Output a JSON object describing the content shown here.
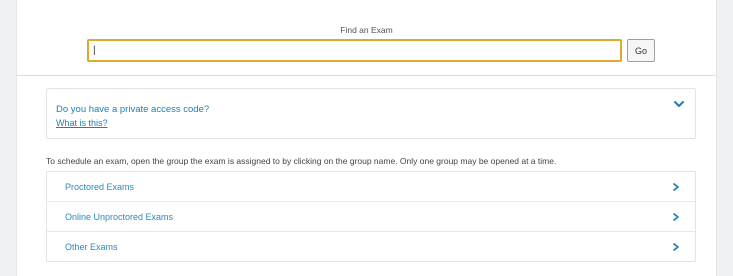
{
  "search": {
    "label": "Find an Exam",
    "value": "|",
    "go_label": "Go"
  },
  "access_code": {
    "question": "Do you have a private access code?",
    "link": "What is this?",
    "chevron_icon": "chevron-down-icon"
  },
  "instructions": "To schedule an exam, open the group the exam is assigned to by clicking on the group name. Only one group may be opened at a time.",
  "groups": [
    {
      "label": "Proctored Exams",
      "icon": "chevron-right-icon"
    },
    {
      "label": "Online Unproctored Exams",
      "icon": "chevron-right-icon"
    },
    {
      "label": "Other Exams",
      "icon": "chevron-right-icon"
    }
  ],
  "colors": {
    "accent": "#1e7fb0",
    "input_focus_border": "#e0a82e"
  }
}
